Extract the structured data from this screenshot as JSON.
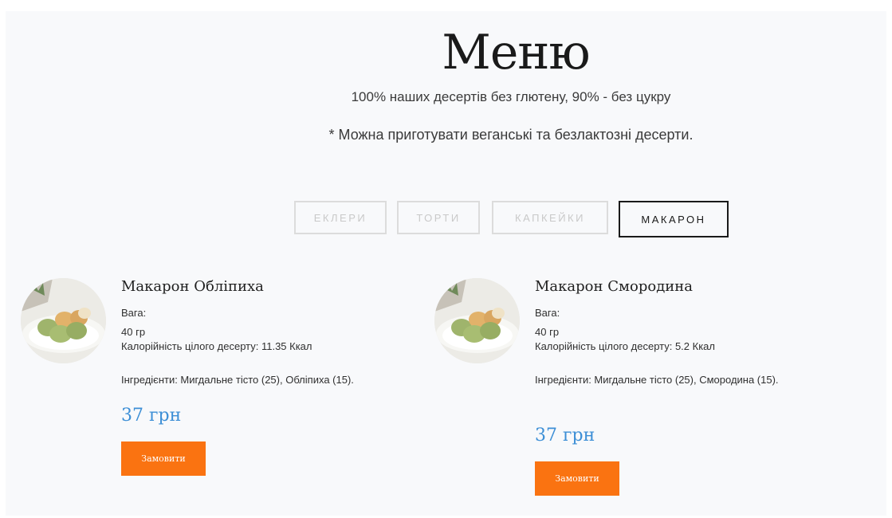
{
  "header": {
    "title": "Меню",
    "subtitle": "100% наших десертів без глютену, 90% - без цукру",
    "note": "* Можна приготувати веганські та безлактозні десерти."
  },
  "tabs": [
    {
      "label": "ЕКЛЕРИ",
      "active": false
    },
    {
      "label": "ТОРТИ",
      "active": false
    },
    {
      "label": "КАПКЕЙКИ",
      "active": false
    },
    {
      "label": "МАКАРОН",
      "active": true
    }
  ],
  "products": [
    {
      "name": "Макарон Обліпиха",
      "weight": "Вага: 40 гр",
      "calories": "Калорійність цілого десерту: 11.35 Ккал",
      "ingredients": "Інгредієнти: Мигдальне тісто (25), Обліпиха (15).",
      "price": "37 грн",
      "order_label": "Замовити"
    },
    {
      "name": "Макарон Смородина",
      "weight": "Вага: 40 гр",
      "calories": "Калорійність цілого десерту: 5.2 Ккал",
      "ingredients": "Інгредієнти: Мигдальне тісто (25), Смородина (15).",
      "price": "37 грн",
      "order_label": "Замовити"
    }
  ],
  "colors": {
    "accent_orange": "#fa7311",
    "price_blue": "#3d8fd6",
    "background": "#f8f9fb"
  }
}
